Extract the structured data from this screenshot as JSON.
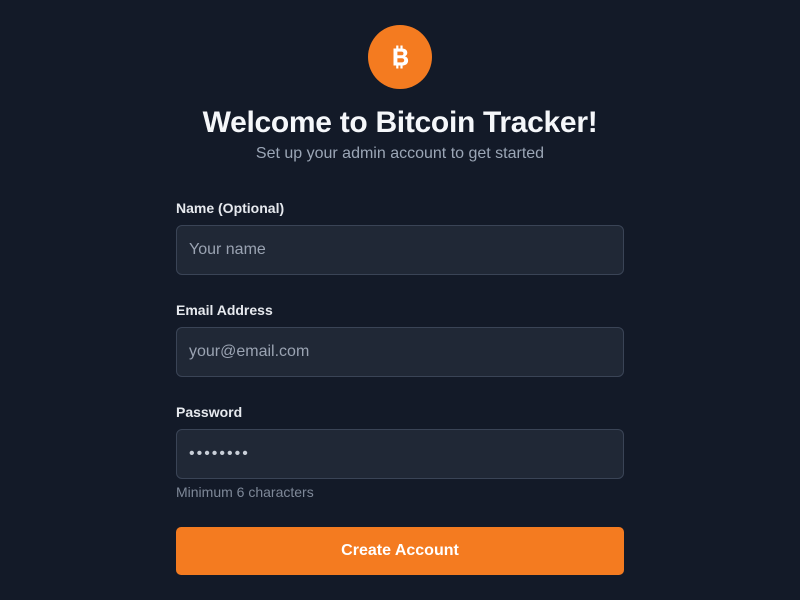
{
  "colors": {
    "background": "#131a28",
    "accent": "#f47b20",
    "input_background": "#202836",
    "input_border": "#3a4456"
  },
  "header": {
    "logo_icon": "bitcoin-icon",
    "title": "Welcome to Bitcoin Tracker!",
    "subtitle": "Set up your admin account to get started"
  },
  "form": {
    "name": {
      "label": "Name (Optional)",
      "placeholder": "Your name",
      "value": ""
    },
    "email": {
      "label": "Email Address",
      "placeholder": "your@email.com",
      "value": ""
    },
    "password": {
      "label": "Password",
      "value": "••••••••",
      "hint": "Minimum 6 characters"
    },
    "submit_label": "Create Account"
  }
}
